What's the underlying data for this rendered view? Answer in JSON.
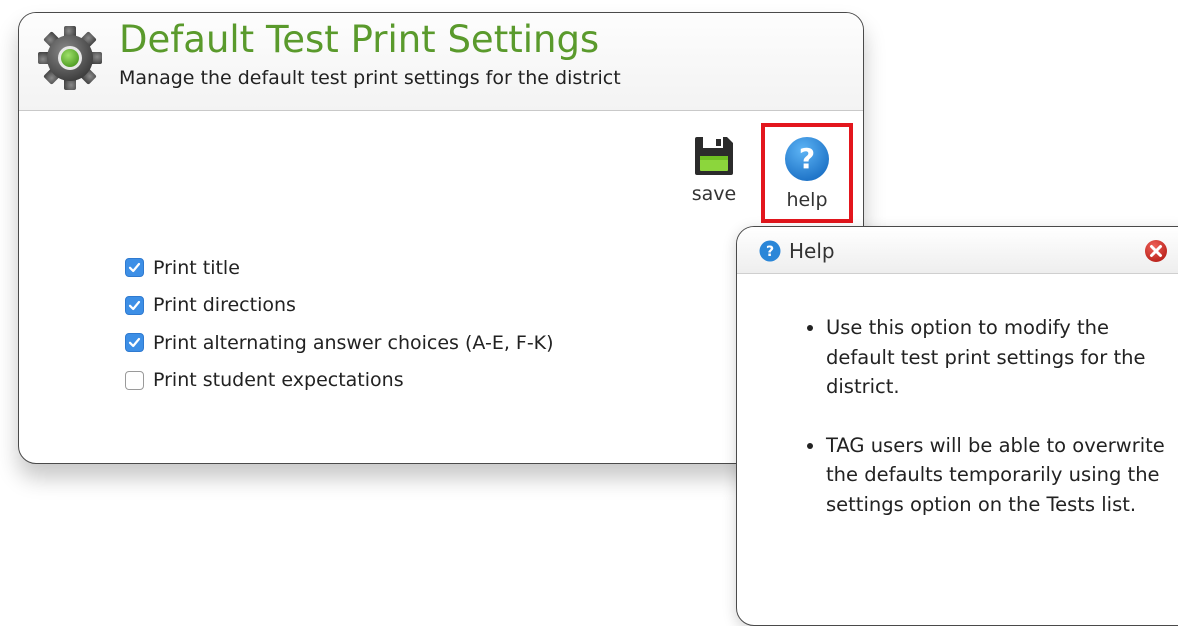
{
  "header": {
    "title": "Default Test Print Settings",
    "subtitle": "Manage the default test print settings for the district",
    "icon": "gear-icon"
  },
  "toolbar": {
    "save_label": "save",
    "help_label": "help",
    "save_icon": "floppy-disk-icon",
    "help_icon": "question-mark-icon",
    "highlight_color": "#e3161d"
  },
  "options": [
    {
      "label": "Print title",
      "checked": true
    },
    {
      "label": "Print directions",
      "checked": true
    },
    {
      "label": "Print alternating answer choices (A-E, F-K)",
      "checked": true
    },
    {
      "label": "Print student expectations",
      "checked": false
    }
  ],
  "help_popup": {
    "title": "Help",
    "close_icon": "close-icon",
    "bullets": [
      "Use this option to modify the default test print settings for the district.",
      "TAG users will be able to overwrite the defaults temporarily using the settings option on the Tests list."
    ]
  },
  "colors": {
    "title_green": "#5a9a2c",
    "checkbox_blue": "#3d8fe6",
    "help_blue": "#2a86d8",
    "close_red": "#d9322b"
  }
}
